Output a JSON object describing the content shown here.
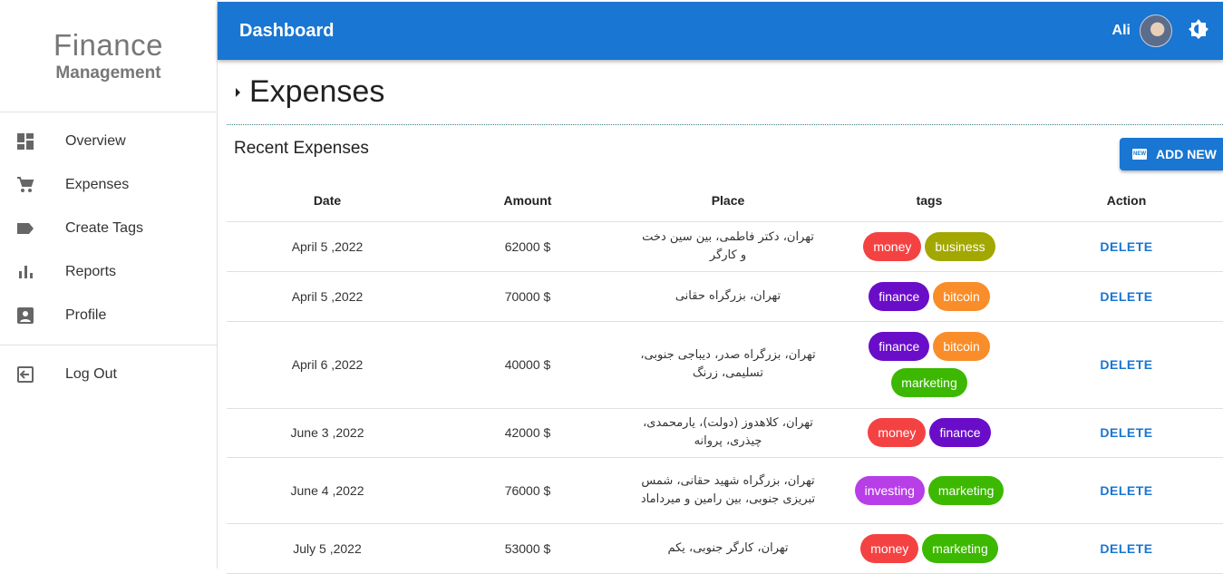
{
  "sidebar": {
    "brand_title": "Finance",
    "brand_sub": "Management",
    "items": [
      {
        "label": "Overview",
        "icon": "dashboard-icon"
      },
      {
        "label": "Expenses",
        "icon": "cart-icon"
      },
      {
        "label": "Create Tags",
        "icon": "tag-icon"
      },
      {
        "label": "Reports",
        "icon": "bar-chart-icon"
      },
      {
        "label": "Profile",
        "icon": "profile-icon"
      }
    ],
    "logout": {
      "label": "Log Out",
      "icon": "logout-icon"
    }
  },
  "header": {
    "title": "Dashboard",
    "user": "Ali",
    "accent": "#1976d2"
  },
  "main": {
    "section_title": "Expenses",
    "recent_title": "Recent Expenses",
    "add_button": "ADD NEW",
    "columns": [
      "Date",
      "Amount",
      "Place",
      "tags",
      "Action"
    ],
    "rows": [
      {
        "date": "April 5 ,2022",
        "amount": "62000 $",
        "place": "تهران، دکتر فاطمی، بین سین دخت و کارگر",
        "tags": [
          "money",
          "business"
        ],
        "action": "DELETE"
      },
      {
        "date": "April 5 ,2022",
        "amount": "70000 $",
        "place": "تهران، بزرگراه حقانی",
        "tags": [
          "finance",
          "bitcoin"
        ],
        "action": "DELETE"
      },
      {
        "date": "April 6 ,2022",
        "amount": "40000 $",
        "place": "تهران، بزرگراه صدر، دیباجی جنوبی، تسلیمی، زرنگ",
        "tags": [
          "finance",
          "bitcoin",
          "marketing"
        ],
        "action": "DELETE"
      },
      {
        "date": "June 3 ,2022",
        "amount": "42000 $",
        "place": "تهران، کلاهدوز (دولت)، یارمحمدی، چیذری، پروانه",
        "tags": [
          "money",
          "finance"
        ],
        "action": "DELETE"
      },
      {
        "date": "June 4 ,2022",
        "amount": "76000 $",
        "place": "تهران، بزرگراه شهید حقانی، شمس تبریزی جنوبی، بین رامین و میرداماد",
        "tags": [
          "investing",
          "marketing"
        ],
        "action": "DELETE"
      },
      {
        "date": "July 5 ,2022",
        "amount": "53000 $",
        "place": "تهران، کارگر جنوبی، یکم",
        "tags": [
          "money",
          "marketing"
        ],
        "action": "DELETE"
      }
    ]
  },
  "tag_colors": {
    "money": "#f44242",
    "business": "#a3a800",
    "finance": "#6a0dc9",
    "bitcoin": "#f98d2a",
    "marketing": "#3cb800",
    "investing": "#b83ee8"
  }
}
